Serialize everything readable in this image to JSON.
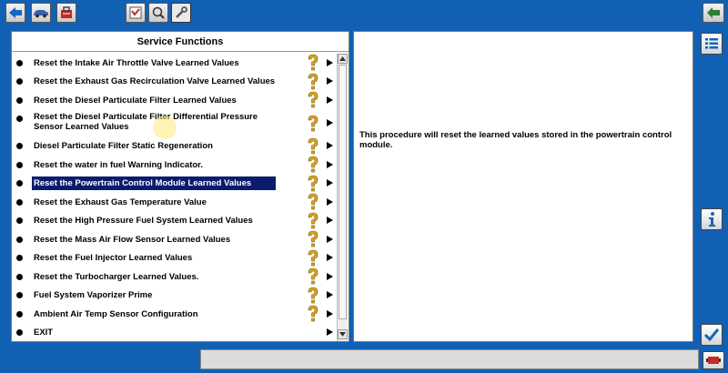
{
  "toolbar": {
    "left_icons": [
      "back-arrow-icon",
      "vehicle-icon",
      "toolbox-icon"
    ],
    "mode_icons": [
      "checklist-icon",
      "search-car-icon",
      "wrench-icon"
    ],
    "right_icon": "back-green-arrow-icon"
  },
  "service_panel": {
    "title": "Service Functions",
    "items": [
      {
        "label": "Reset the Intake Air Throttle Valve Learned Values"
      },
      {
        "label": "Reset the Exhaust Gas Recirculation Valve Learned Values"
      },
      {
        "label": "Reset the Diesel Particulate Filter Learned Values"
      },
      {
        "label": "Reset the Diesel Particulate Filter Differential Pressure\nSensor Learned Values"
      },
      {
        "label": "Diesel Particulate Filter Static Regeneration"
      },
      {
        "label": "Reset the water in fuel Warning Indicator."
      },
      {
        "label": "Reset the Powertrain Control Module Learned Values",
        "selected": true
      },
      {
        "label": "Reset the Exhaust Gas Temperature Value"
      },
      {
        "label": "Reset the High Pressure Fuel System Learned Values"
      },
      {
        "label": "Reset the Mass Air Flow Sensor Learned Values"
      },
      {
        "label": "Reset the Fuel Injector Learned Values"
      },
      {
        "label": "Reset the Turbocharger Learned Values."
      },
      {
        "label": "Fuel System Vaporizer Prime"
      },
      {
        "label": "Ambient Air Temp Sensor Configuration"
      },
      {
        "label": "EXIT",
        "no_help": true
      }
    ]
  },
  "description": {
    "text": "This procedure will reset the learned values stored in the powertrain control module."
  },
  "side_buttons": [
    "list-icon",
    "info-icon",
    "checkmark-icon"
  ],
  "status": {
    "icon": "vci-connection-icon"
  },
  "colors": {
    "background": "#1260b4",
    "selection": "#0a1c6e",
    "help_icon": "#d9a520"
  }
}
